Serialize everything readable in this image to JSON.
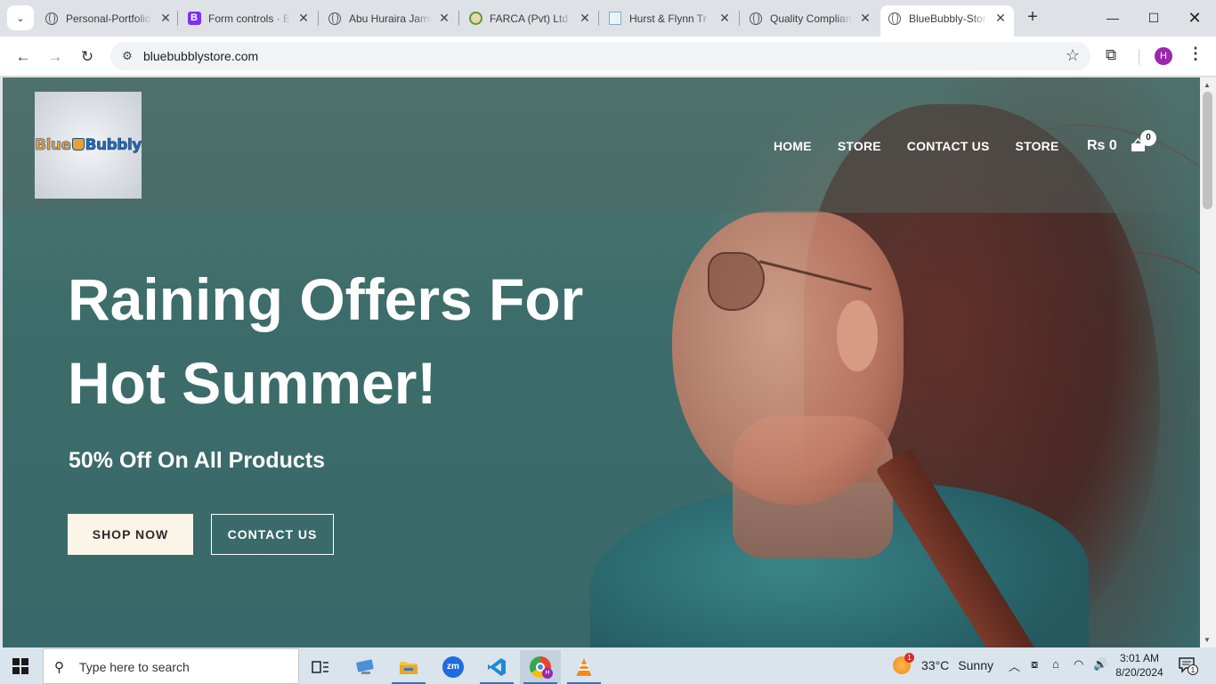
{
  "browser": {
    "tabs": [
      {
        "title": "Personal-Portfolio",
        "favicon": "globe-icon"
      },
      {
        "title": "Form controls · Bootstrap",
        "favicon": "bootstrap-icon"
      },
      {
        "title": "Abu Huraira Jamil",
        "favicon": "globe-icon"
      },
      {
        "title": "FARCA (Pvt) Ltd",
        "favicon": "farca-icon"
      },
      {
        "title": "Hurst & Flynn Tr",
        "favicon": "hurst-icon"
      },
      {
        "title": "Quality Compliance",
        "favicon": "globe-icon"
      },
      {
        "title": "BlueBubbly-Store",
        "favicon": "globe-icon",
        "active": true
      }
    ],
    "url": "bluebubblystore.com",
    "profile_initial": "H"
  },
  "site": {
    "logo": {
      "part1": "Blue",
      "part2": "Bubbly"
    },
    "nav": [
      "HOME",
      "STORE",
      "CONTACT US",
      "STORE"
    ],
    "cart_total": "Rs 0",
    "cart_count": "0",
    "hero": {
      "title": "Raining Offers For Hot Summer!",
      "subtitle": "50% Off On All Products",
      "primary_button": "SHOP NOW",
      "secondary_button": "CONTACT US"
    },
    "colors": {
      "shop_button_bg": "#fbf5e9",
      "hero_overlay": "#3d6d6a"
    }
  },
  "taskbar": {
    "search_placeholder": "Type here to search",
    "weather": {
      "temp": "33°C",
      "condition": "Sunny",
      "badge": "1"
    },
    "time": "3:01 AM",
    "date": "8/20/2024",
    "notification_count": "1"
  }
}
